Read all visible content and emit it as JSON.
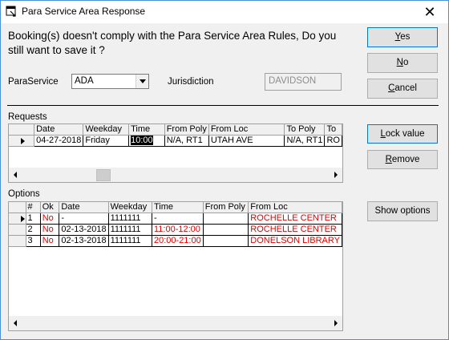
{
  "window": {
    "title": "Para Service Area Response",
    "close_glyph": "✕"
  },
  "message": "Booking(s) doesn't comply with the Para Service Area Rules, Do you still want to save it ?",
  "buttons": {
    "yes": {
      "mnemonic": "Y",
      "rest": "es"
    },
    "no": {
      "mnemonic": "N",
      "rest": "o"
    },
    "cancel": {
      "mnemonic": "C",
      "rest": "ancel"
    },
    "lock_value": {
      "mnemonic": "L",
      "rest": "ock value"
    },
    "remove": {
      "mnemonic": "R",
      "rest": "emove"
    },
    "show_options": "Show options"
  },
  "form": {
    "paraservice_label": "ParaService",
    "paraservice_value": "ADA",
    "jurisdiction_label": "Jurisdiction",
    "jurisdiction_value": "DAVIDSON"
  },
  "requests": {
    "label": "Requests",
    "columns": [
      "Date",
      "Weekday",
      "Time",
      "From Poly",
      "From Loc",
      "To Poly",
      "To"
    ],
    "rows": [
      [
        "04-27-2018",
        "Friday",
        "10:00",
        "N/A, RT1",
        "UTAH AVE",
        "N/A, RT1",
        "RO"
      ]
    ]
  },
  "options": {
    "label": "Options",
    "columns": [
      "#",
      "Ok",
      "Date",
      "Weekday",
      "Time",
      "From Poly",
      "From Loc"
    ],
    "rows": [
      [
        "1",
        "No",
        "-",
        "1111111",
        "-",
        "",
        "ROCHELLE CENTER"
      ],
      [
        "2",
        "No",
        "02-13-2018",
        "1111111",
        "11:00-12:00",
        "",
        "ROCHELLE CENTER"
      ],
      [
        "3",
        "No",
        "02-13-2018",
        "1111111",
        "20:00-21:00",
        "",
        "DONELSON LIBRARY"
      ]
    ]
  },
  "colors": {
    "accent": "#0078d7",
    "warning_text": "#e00000"
  },
  "icons": {
    "app": "window-app-icon",
    "close": "close-icon",
    "row_indicator": "row-pointer-icon"
  }
}
